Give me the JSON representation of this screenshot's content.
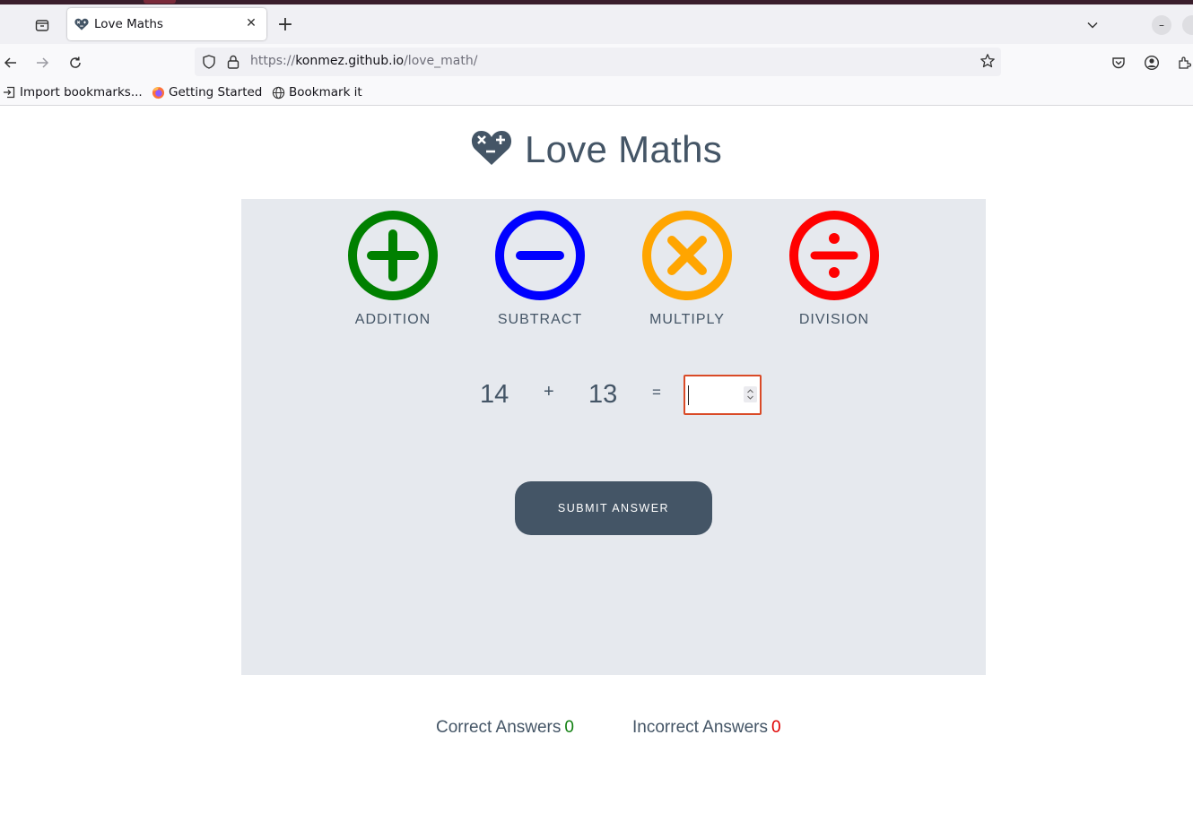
{
  "browser": {
    "tab_title": "Love Maths",
    "url_domain": "https://konmez.github.io",
    "url_path": "/love_math/",
    "new_tab_label": "+",
    "close_label": "✕",
    "minimize_label": "–",
    "bookmarks": [
      {
        "label": "Import bookmarks...",
        "icon": "import-icon"
      },
      {
        "label": "Getting Started",
        "icon": "firefox-icon"
      },
      {
        "label": "Bookmark it",
        "icon": "globe-icon"
      }
    ]
  },
  "page": {
    "title": "Love Maths",
    "logo_icon": "heart-math-icon",
    "operations": [
      {
        "label": "ADDITION",
        "icon": "plus-circle-icon",
        "color": "#008000"
      },
      {
        "label": "SUBTRACT",
        "icon": "minus-circle-icon",
        "color": "#0000ff"
      },
      {
        "label": "MULTIPLY",
        "icon": "times-circle-icon",
        "color": "#ffa500"
      },
      {
        "label": "DIVISION",
        "icon": "divide-circle-icon",
        "color": "#ff0000"
      }
    ],
    "question": {
      "operand1": "14",
      "operator": "+",
      "operand2": "13",
      "equals": "=",
      "answer_value": ""
    },
    "submit_label": "SUBMIT ANSWER",
    "scores": {
      "correct_label": "Correct Answers",
      "correct_value": "0",
      "incorrect_label": "Incorrect Answers",
      "incorrect_value": "0"
    },
    "colors": {
      "text": "#445566",
      "game_area_bg": "#e6e9ee",
      "answer_border": "#d94a27",
      "correct": "#128012",
      "incorrect": "#e00000"
    }
  }
}
